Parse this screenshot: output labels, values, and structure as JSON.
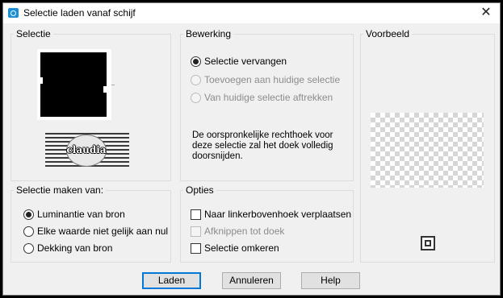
{
  "window": {
    "title": "Selectie laden vanaf schijf"
  },
  "groups": {
    "selectie": "Selectie",
    "bewerking": "Bewerking",
    "voorbeeld": "Voorbeeld",
    "maken_van": "Selectie maken van:",
    "opties": "Opties"
  },
  "logo_text": "claudia",
  "bewerking": {
    "options": [
      {
        "label": "Selectie vervangen",
        "checked": true,
        "enabled": true
      },
      {
        "label": "Toevoegen aan huidige selectie",
        "checked": false,
        "enabled": false
      },
      {
        "label": "Van huidige selectie aftrekken",
        "checked": false,
        "enabled": false
      }
    ],
    "description": "De oorspronkelijke rechthoek voor deze selectie zal het doek volledig doorsnijden."
  },
  "maken_van": {
    "options": [
      {
        "label": "Luminantie van bron",
        "checked": true
      },
      {
        "label": "Elke waarde niet gelijk aan nul",
        "checked": false
      },
      {
        "label": "Dekking van bron",
        "checked": false
      }
    ]
  },
  "opties": {
    "items": [
      {
        "label": "Naar linkerbovenhoek verplaatsen",
        "checked": false,
        "enabled": true
      },
      {
        "label": "Afknippen tot doek",
        "checked": false,
        "enabled": false
      },
      {
        "label": "Selectie omkeren",
        "checked": false,
        "enabled": true
      }
    ]
  },
  "buttons": {
    "ok": "Laden",
    "cancel": "Annuleren",
    "help": "Help"
  }
}
